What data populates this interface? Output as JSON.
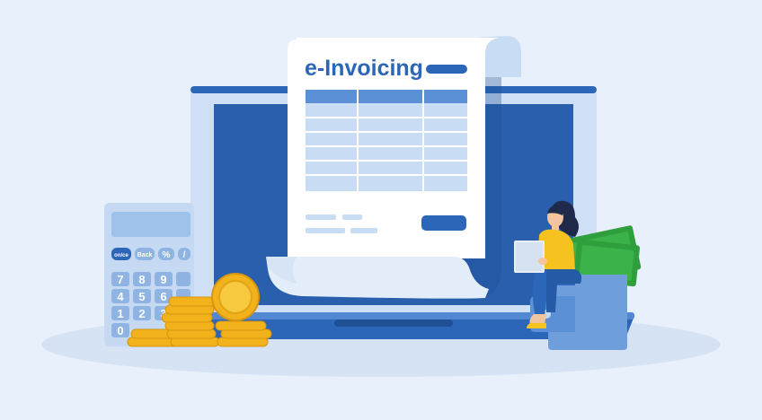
{
  "invoice": {
    "title": "e-Invoicing"
  },
  "calculator": {
    "keys_top": [
      "on/ce",
      "Back",
      "%",
      "/"
    ],
    "keys_digits": [
      "7",
      "8",
      "9",
      "4",
      "5",
      "6",
      "1",
      "2",
      "3",
      "0"
    ]
  },
  "colors": {
    "background": "#e8f0fb",
    "floor": "#d5e3f5",
    "laptop_frame": "#cfe0f6",
    "laptop_screen": "#2a5fae",
    "accent": "#2b66b8",
    "paper": "#ffffff",
    "gold": "#f2b21b",
    "money": "#2f9e3c",
    "shirt": "#f6c21f"
  },
  "icons": {
    "laptop": "laptop-icon",
    "calculator": "calculator-icon",
    "coins": "coin-stack-icon",
    "wallet": "wallet-icon",
    "person": "person-with-laptop-icon"
  }
}
